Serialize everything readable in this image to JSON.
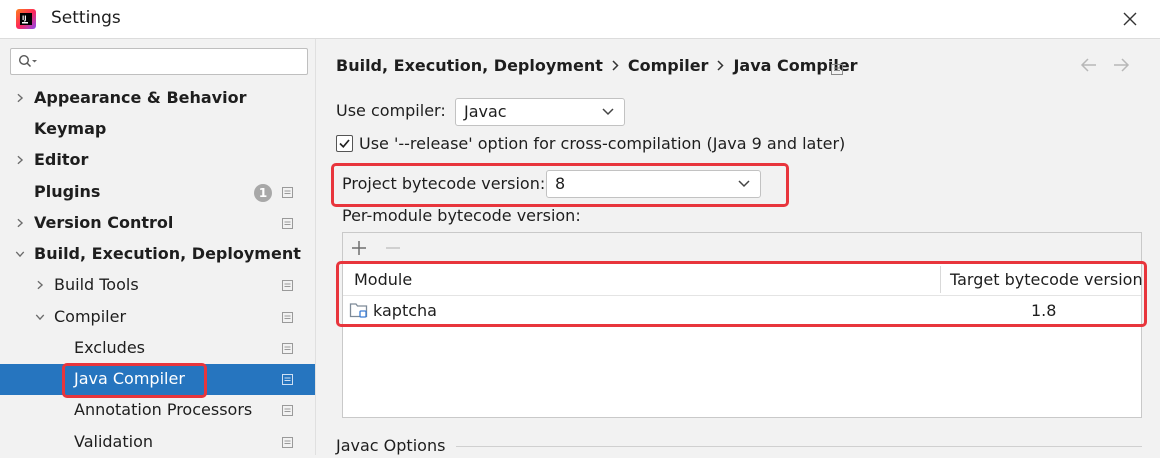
{
  "window": {
    "title": "Settings",
    "close_icon": "close-icon"
  },
  "sidebar": {
    "search": {
      "placeholder": "",
      "value": ""
    },
    "items": [
      {
        "label": "Appearance & Behavior",
        "bold": true,
        "expander": "collapsed"
      },
      {
        "label": "Keymap",
        "bold": true,
        "expander": "none"
      },
      {
        "label": "Editor",
        "bold": true,
        "expander": "collapsed"
      },
      {
        "label": "Plugins",
        "bold": true,
        "expander": "none",
        "badge": "1"
      },
      {
        "label": "Version Control",
        "bold": true,
        "expander": "collapsed"
      },
      {
        "label": "Build, Execution, Deployment",
        "bold": true,
        "expander": "expanded"
      },
      {
        "label": "Build Tools",
        "bold": false,
        "expander": "collapsed"
      },
      {
        "label": "Compiler",
        "bold": false,
        "expander": "expanded"
      },
      {
        "label": "Excludes",
        "bold": false,
        "expander": "none"
      },
      {
        "label": "Java Compiler",
        "bold": false,
        "expander": "none",
        "selected": true
      },
      {
        "label": "Annotation Processors",
        "bold": false,
        "expander": "none"
      },
      {
        "label": "Validation",
        "bold": false,
        "expander": "none"
      }
    ]
  },
  "breadcrumb": [
    "Build, Execution, Deployment",
    "Compiler",
    "Java Compiler"
  ],
  "main": {
    "use_compiler_label": "Use compiler:",
    "use_compiler_value": "Javac",
    "release_option_label": "Use '--release' option for cross-compilation (Java 9 and later)",
    "release_option_checked": true,
    "project_bytecode_label": "Project bytecode version:",
    "project_bytecode_value": "8",
    "per_module_label": "Per-module bytecode version:",
    "table": {
      "columns": [
        "Module",
        "Target bytecode version"
      ],
      "rows": [
        {
          "module": "kaptcha",
          "target": "1.8"
        }
      ]
    },
    "javac_options_label": "Javac Options"
  },
  "colors": {
    "accent_selected": "#2675bf",
    "highlight_box": "#e8353c"
  }
}
